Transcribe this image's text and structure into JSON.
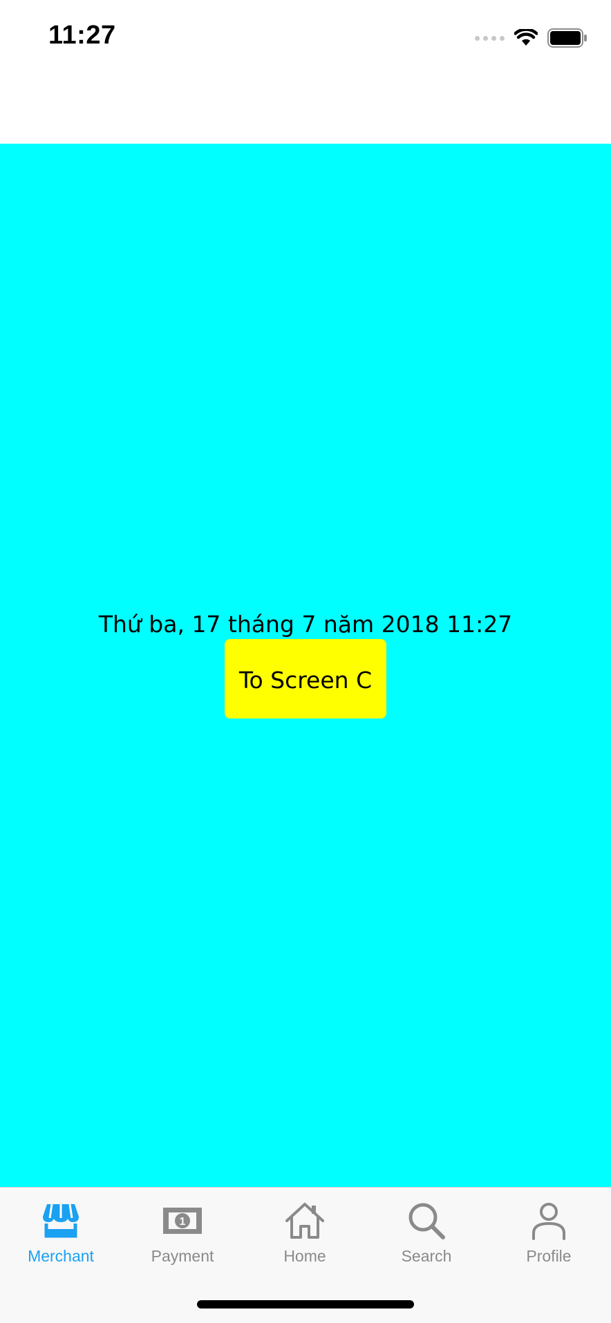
{
  "status_bar": {
    "time": "11:27",
    "signal_icon": "cellular-signal-icon",
    "wifi_icon": "wifi-icon",
    "battery_icon": "battery-icon"
  },
  "content": {
    "background_color": "#00ffff",
    "date_text": "Thứ ba, 17 tháng 7 năm 2018 11:27",
    "button_label": "To Screen C",
    "button_color": "#ffff00"
  },
  "tab_bar": {
    "active_color": "#1ba1f2",
    "inactive_color": "#8a8a8a",
    "tabs": [
      {
        "label": "Merchant",
        "icon": "storefront-icon",
        "active": true
      },
      {
        "label": "Payment",
        "icon": "banknote-icon",
        "active": false
      },
      {
        "label": "Home",
        "icon": "home-icon",
        "active": false
      },
      {
        "label": "Search",
        "icon": "search-icon",
        "active": false
      },
      {
        "label": "Profile",
        "icon": "person-icon",
        "active": false
      }
    ]
  }
}
